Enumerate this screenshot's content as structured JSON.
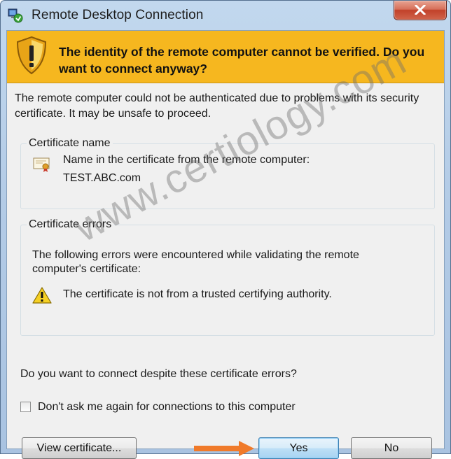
{
  "window": {
    "title": "Remote Desktop Connection",
    "close_icon": "close-icon",
    "app_icon": "remote-desktop-icon"
  },
  "banner": {
    "icon": "shield-warning-icon",
    "text": "The identity of the remote computer cannot be verified. Do you want to connect anyway?",
    "color": "#f6b71f"
  },
  "intro": "The remote computer could not be authenticated due to problems with its security certificate. It may be unsafe to proceed.",
  "certificate_name": {
    "title": "Certificate name",
    "icon": "certificate-icon",
    "label": "Name in the certificate from the remote computer:",
    "value": "TEST.ABC.com"
  },
  "certificate_errors": {
    "title": "Certificate errors",
    "intro": "The following errors were encountered while validating the remote computer's certificate:",
    "icon": "warning-icon",
    "items": [
      "The certificate is not from a trusted certifying authority."
    ]
  },
  "question": "Do you want to connect despite these certificate errors?",
  "checkbox": {
    "label": "Don't ask me again for connections to this computer",
    "checked": false
  },
  "buttons": {
    "view_certificate": "View certificate...",
    "yes": "Yes",
    "no": "No"
  },
  "annotation_arrow": {
    "icon": "arrow-right-icon",
    "color": "#f07a2a"
  },
  "watermark": "www.certiology.com"
}
